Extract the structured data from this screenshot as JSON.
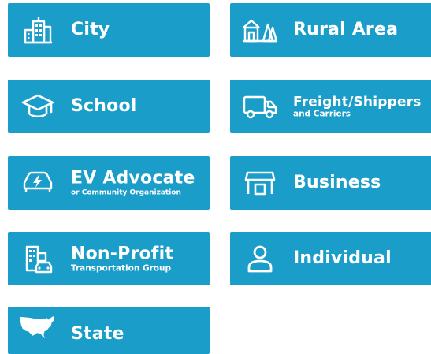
{
  "tiles": [
    {
      "title": "City",
      "sub": ""
    },
    {
      "title": "Rural Area",
      "sub": ""
    },
    {
      "title": "School",
      "sub": ""
    },
    {
      "title": "Freight/Shippers",
      "sub": "and Carriers"
    },
    {
      "title": "EV Advocate",
      "sub": "or Community Organization"
    },
    {
      "title": "Business",
      "sub": ""
    },
    {
      "title": "Non-Profit",
      "sub": "Transportation Group"
    },
    {
      "title": "Individual",
      "sub": ""
    },
    {
      "title": "State",
      "sub": ""
    }
  ],
  "colors": {
    "tile": "#1a9ec9",
    "text": "#ffffff"
  },
  "icons": [
    "city-buildings-icon",
    "rural-barn-trees-icon",
    "graduation-cap-icon",
    "delivery-truck-icon",
    "ev-charging-car-icon",
    "storefront-icon",
    "buildings-with-car-icon",
    "person-icon",
    "usa-map-icon"
  ]
}
